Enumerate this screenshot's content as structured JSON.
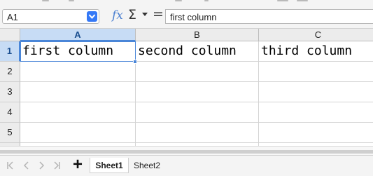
{
  "formula_bar": {
    "name_box": "A1",
    "formula": "first column",
    "fx_symbol": "fx",
    "sum_symbol": "Σ",
    "equals_symbol": "="
  },
  "grid": {
    "columns": [
      "A",
      "B",
      "C"
    ],
    "rows": [
      "1",
      "2",
      "3",
      "4",
      "5"
    ],
    "cells": {
      "A1": "first column",
      "B1": "second column",
      "C1": "third column"
    },
    "active_cell": "A1"
  },
  "sheets": {
    "add_label": "+",
    "tabs": [
      "Sheet1",
      "Sheet2"
    ],
    "active": "Sheet1"
  },
  "colors": {
    "accent": "#4a86d8",
    "selected_header": "#c7dcf5",
    "name_box_button": "#3478f6"
  }
}
